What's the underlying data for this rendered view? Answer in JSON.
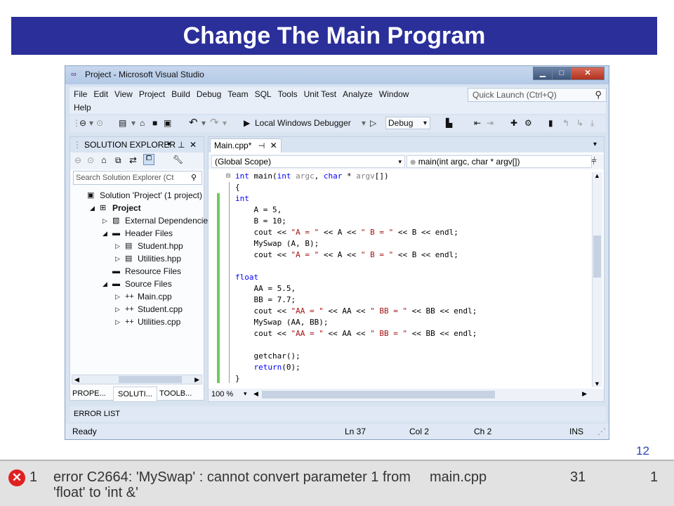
{
  "slide": {
    "title": "Change The Main Program",
    "page_number": "12"
  },
  "window": {
    "title": "Project - Microsoft Visual Studio",
    "min": "▁",
    "max": "□",
    "close": "✕"
  },
  "menu": {
    "items": [
      "File",
      "Edit",
      "View",
      "Project",
      "Build",
      "Debug",
      "Team",
      "SQL",
      "Tools",
      "Unit Test",
      "Analyze",
      "Window"
    ],
    "help": "Help",
    "quick_launch_placeholder": "Quick Launch (Ctrl+Q)"
  },
  "toolbar": {
    "debugger_label": "Local Windows Debugger",
    "config_value": "Debug"
  },
  "solution_explorer": {
    "header": "SOLUTION EXPLORER",
    "search_placeholder": "Search Solution Explorer (Ct",
    "tree": [
      {
        "label": "Solution 'Project' (1 project)",
        "indent": 0,
        "arrow": "",
        "icon": "solution-icon"
      },
      {
        "label": "Project",
        "indent": 1,
        "arrow": "◢",
        "icon": "project-icon",
        "bold": true
      },
      {
        "label": "External Dependencies",
        "indent": 2,
        "arrow": "▷",
        "icon": "dependencies-icon"
      },
      {
        "label": "Header Files",
        "indent": 2,
        "arrow": "◢",
        "icon": "folder-icon"
      },
      {
        "label": "Student.hpp",
        "indent": 3,
        "arrow": "▷",
        "icon": "header-file-icon"
      },
      {
        "label": "Utilities.hpp",
        "indent": 3,
        "arrow": "▷",
        "icon": "header-file-icon"
      },
      {
        "label": "Resource Files",
        "indent": 2,
        "arrow": "",
        "icon": "folder-icon"
      },
      {
        "label": "Source Files",
        "indent": 2,
        "arrow": "◢",
        "icon": "folder-icon"
      },
      {
        "label": "Main.cpp",
        "indent": 3,
        "arrow": "▷",
        "icon": "cpp-file-icon"
      },
      {
        "label": "Student.cpp",
        "indent": 3,
        "arrow": "▷",
        "icon": "cpp-file-icon"
      },
      {
        "label": "Utilities.cpp",
        "indent": 3,
        "arrow": "▷",
        "icon": "cpp-file-icon"
      }
    ],
    "bottom_tabs": [
      "PROPE...",
      "SOLUTI...",
      "TOOLB..."
    ]
  },
  "editor": {
    "tab_label": "Main.cpp*",
    "scope_dropdown": "(Global Scope)",
    "member_dropdown": "main(int argc, char * argv[])",
    "zoom": "100 %",
    "code_lines": [
      [
        [
          "kw",
          "int"
        ],
        [
          "t",
          " main("
        ],
        [
          "kw",
          "int"
        ],
        [
          "t",
          " "
        ],
        [
          "param",
          "argc"
        ],
        [
          "t",
          ", "
        ],
        [
          "kw",
          "char"
        ],
        [
          "t",
          " * "
        ],
        [
          "param",
          "argv"
        ],
        [
          "t",
          "[])"
        ]
      ],
      [
        [
          "t",
          "{"
        ]
      ],
      [
        [
          "kw",
          "int"
        ]
      ],
      [
        [
          "t",
          "    A = 5,"
        ]
      ],
      [
        [
          "t",
          "    B = 10;"
        ]
      ],
      [
        [
          "t",
          "    cout << "
        ],
        [
          "str",
          "\"A = \""
        ],
        [
          "t",
          " << A << "
        ],
        [
          "str",
          "\" B = \""
        ],
        [
          "t",
          " << B << endl;"
        ]
      ],
      [
        [
          "t",
          "    MySwap (A, B);"
        ]
      ],
      [
        [
          "t",
          "    cout << "
        ],
        [
          "str",
          "\"A = \""
        ],
        [
          "t",
          " << A << "
        ],
        [
          "str",
          "\" B = \""
        ],
        [
          "t",
          " << B << endl;"
        ]
      ],
      [
        [
          "t",
          ""
        ]
      ],
      [
        [
          "kw",
          "float"
        ]
      ],
      [
        [
          "t",
          "    AA = 5.5,"
        ]
      ],
      [
        [
          "t",
          "    BB = 7.7;"
        ]
      ],
      [
        [
          "t",
          "    cout << "
        ],
        [
          "str",
          "\"AA = \""
        ],
        [
          "t",
          " << AA << "
        ],
        [
          "str",
          "\" BB = \""
        ],
        [
          "t",
          " << BB << endl;"
        ]
      ],
      [
        [
          "t",
          "    MySwap (AA, BB);"
        ]
      ],
      [
        [
          "t",
          "    cout << "
        ],
        [
          "str",
          "\"AA = \""
        ],
        [
          "t",
          " << AA << "
        ],
        [
          "str",
          "\" BB = \""
        ],
        [
          "t",
          " << BB << endl;"
        ]
      ],
      [
        [
          "t",
          ""
        ]
      ],
      [
        [
          "t",
          "    getchar();"
        ]
      ],
      [
        [
          "t",
          "    "
        ],
        [
          "kw",
          "return"
        ],
        [
          "t",
          "(0);"
        ]
      ],
      [
        [
          "t",
          "}"
        ]
      ]
    ]
  },
  "error_list_label": "ERROR LIST",
  "status": {
    "state": "Ready",
    "ln": "Ln 37",
    "col": "Col 2",
    "ch": "Ch 2",
    "mode": "INS"
  },
  "error_row": {
    "number": "1",
    "description": "error C2664: 'MySwap' : cannot convert parameter 1 from 'float' to 'int &'",
    "file": "main.cpp",
    "line": "31",
    "column": "1"
  }
}
